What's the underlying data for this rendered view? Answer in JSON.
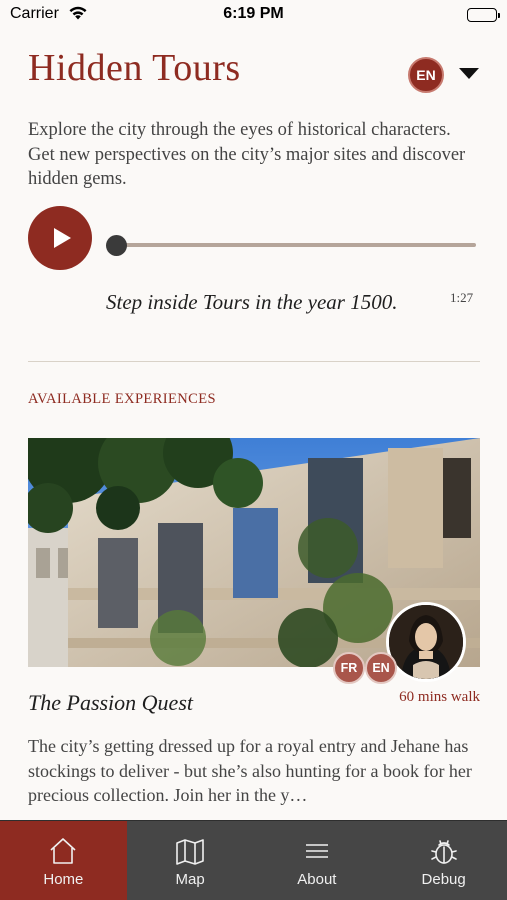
{
  "status_bar": {
    "carrier": "Carrier",
    "time": "6:19 PM"
  },
  "header": {
    "title": "Hidden Tours",
    "language": "EN"
  },
  "intro": {
    "text": "Explore the city through the eyes of historical characters. Get new perspectives on the city’s major sites and discover hidden gems."
  },
  "audio": {
    "caption": "Step inside Tours in the year 1500.",
    "duration": "1:27",
    "progress": 0
  },
  "experiences": {
    "heading": "AVAILABLE EXPERIENCES",
    "items": [
      {
        "title": "The Passion Quest",
        "duration": "60 mins walk",
        "languages": [
          "FR",
          "EN"
        ],
        "description": "The city’s getting dressed up for a royal entry and Jehane has stockings to deliver - but she’s also hunting for a book for her precious collection. Join her in the y…"
      }
    ]
  },
  "tab_bar": {
    "tabs": [
      {
        "label": "Home",
        "icon": "home-icon",
        "active": true
      },
      {
        "label": "Map",
        "icon": "map-icon",
        "active": false
      },
      {
        "label": "About",
        "icon": "menu-lines-icon",
        "active": false
      },
      {
        "label": "Debug",
        "icon": "bug-icon",
        "active": false
      }
    ]
  },
  "colors": {
    "accent": "#8e2b21",
    "tab_bar": "#464646",
    "background": "#fbf9f7"
  }
}
